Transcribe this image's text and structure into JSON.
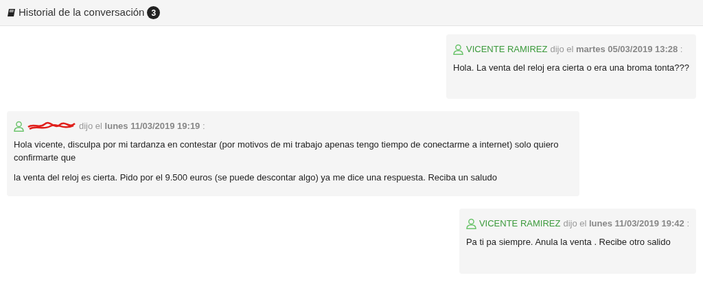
{
  "header": {
    "title": "Historial de la conversación",
    "count": "3"
  },
  "messages": [
    {
      "kind": "outgoing",
      "author": "VICENTE RAMIREZ",
      "author_redacted": false,
      "said": "dijo el",
      "date": "martes 05/03/2019 13:28",
      "colon": ":",
      "paragraphs": [
        "Hola. La venta del reloj era cierta o era una broma tonta???"
      ]
    },
    {
      "kind": "incoming",
      "author_redacted": true,
      "said": "dijo el",
      "date": "lunes 11/03/2019 19:19",
      "colon": ":",
      "paragraphs": [
        "Hola vicente, disculpa por mi tardanza en contestar (por motivos de mi trabajo apenas tengo tiempo de conectarme a internet) solo quiero confirmarte que",
        "la venta del reloj es cierta. Pido por el 9.500 euros (se puede descontar algo) ya me dice una respuesta. Reciba un saludo"
      ]
    },
    {
      "kind": "outgoing",
      "author": "VICENTE RAMIREZ",
      "author_redacted": false,
      "said": "dijo el",
      "date": "lunes 11/03/2019 19:42",
      "colon": ":",
      "paragraphs": [
        "Pa ti pa siempre. Anula la venta . Recibe otro salido"
      ]
    }
  ]
}
